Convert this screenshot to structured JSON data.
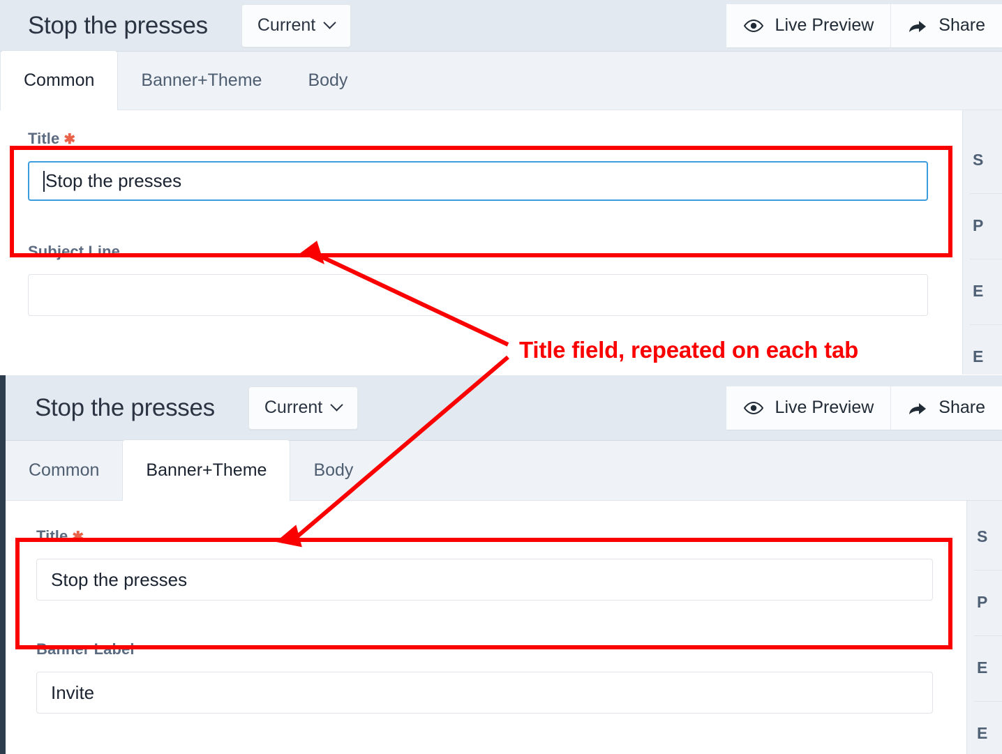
{
  "annotation": {
    "text": "Title field, repeated on each tab",
    "color": "#fb0000"
  },
  "panels": [
    {
      "id": "common-tab-panel",
      "header": {
        "title": "Stop the presses",
        "version_select": {
          "label": "Current",
          "icon": "chevron-down-icon"
        },
        "actions": [
          {
            "label": "Live Preview",
            "icon": "eye-icon"
          },
          {
            "label": "Share",
            "icon": "share-arrow-icon"
          }
        ]
      },
      "tabs": [
        {
          "label": "Common",
          "active": true
        },
        {
          "label": "Banner+Theme",
          "active": false
        },
        {
          "label": "Body",
          "active": false
        }
      ],
      "fields": [
        {
          "label": "Title",
          "required": true,
          "value": "Stop the presses",
          "placeholder": "",
          "focused": true,
          "highlighted": true
        },
        {
          "label": "Subject Line",
          "required": false,
          "value": "",
          "placeholder": "",
          "focused": false,
          "highlighted": false
        }
      ],
      "sidebar_items": [
        "S",
        "P",
        "E",
        "E"
      ]
    },
    {
      "id": "banner-theme-tab-panel",
      "header": {
        "title": "Stop the presses",
        "version_select": {
          "label": "Current",
          "icon": "chevron-down-icon"
        },
        "actions": [
          {
            "label": "Live Preview",
            "icon": "eye-icon"
          },
          {
            "label": "Share",
            "icon": "share-arrow-icon"
          }
        ]
      },
      "tabs": [
        {
          "label": "Common",
          "active": false
        },
        {
          "label": "Banner+Theme",
          "active": true
        },
        {
          "label": "Body",
          "active": false
        }
      ],
      "fields": [
        {
          "label": "Title",
          "required": true,
          "value": "Stop the presses",
          "placeholder": "",
          "focused": false,
          "highlighted": true
        },
        {
          "label": "Banner Label",
          "required": false,
          "value": "Invite",
          "placeholder": "",
          "focused": false,
          "highlighted": false
        }
      ],
      "sidebar_items": [
        "S",
        "P",
        "E",
        "E"
      ]
    }
  ],
  "colors": {
    "header_bg": "#e3e9f0",
    "tabstrip_bg": "#eff3f7",
    "rail": "#2e3d4e",
    "focus_border": "#3b9ddd",
    "required_star": "#e8634a",
    "annotation": "#fb0000"
  }
}
